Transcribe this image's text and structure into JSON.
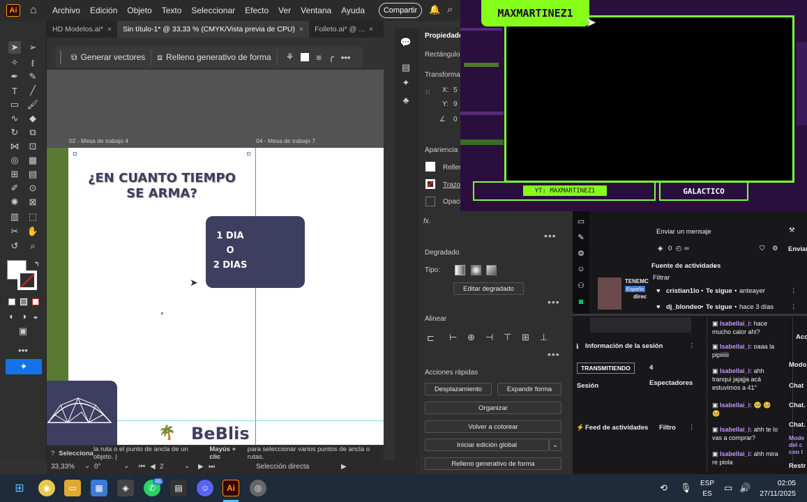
{
  "app": {
    "logo": "Ai",
    "menu": [
      "Archivo",
      "Edición",
      "Objeto",
      "Texto",
      "Seleccionar",
      "Efecto",
      "Ver",
      "Ventana",
      "Ayuda"
    ],
    "share_label": "Compartir"
  },
  "tabs": [
    {
      "label": "HD Modelos.ai*",
      "close": "×",
      "active": false
    },
    {
      "label": "Sin título-1* @ 33,33 % (CMYK/Vista previa de CPU)",
      "close": "×",
      "active": true
    },
    {
      "label": "Folleto.ai* @ ...",
      "close": "×",
      "active": false
    }
  ],
  "context_bar": {
    "generate_vectors": "Generar vectores",
    "generative_fill": "Relleno generativo de forma"
  },
  "canvas": {
    "artboard_labels": [
      "02 - Mesa de trabajo 4",
      "04 - Mesa de trabajo 7"
    ],
    "headline_line1": "¿EN CUANTO TIEMPO",
    "headline_line2": "SE ARMA?",
    "days_line1": "1 DIA",
    "days_line2": "O",
    "days_line3": "2 DIAS",
    "brand": "BeBlis"
  },
  "hint": {
    "bold1": "Selecciona",
    "text1": " la ruta o el punto de ancla de un objeto. | ",
    "bold2": "Mayús + clic",
    "text2": " para seleccionar varios puntos de ancla o rutas."
  },
  "status": {
    "zoom": "33,33%",
    "rotation": "0°",
    "artboard_num": "2",
    "tool": "Selección directa"
  },
  "properties": {
    "tab": "Propiedades",
    "object_type": "Rectángulo",
    "transform_title": "Transformar",
    "x_label": "X:",
    "x_value": "5",
    "y_label": "Y:",
    "y_value": "9",
    "angle_value": "0",
    "appearance_title": "Apariencia",
    "fill_label": "Relleno",
    "stroke_label": "Trazo",
    "opacity_label": "Opacidad",
    "fx": "fx.",
    "gradient_title": "Degradado",
    "type_label": "Tipo:",
    "edit_gradient": "Editar degradado",
    "align_title": "Alinear",
    "quick_actions_title": "Acciones rápidas",
    "btn_offset": "Desplazamiento",
    "btn_expand": "Expandir forma",
    "btn_arrange": "Organizar",
    "btn_recolor": "Volver a colorear",
    "btn_global_edit": "Iniciar edición global",
    "btn_generative": "Relleno generativo de forma"
  },
  "stream": {
    "name": "MAXMARTINEZ1",
    "yt_label": "YT: MAXMARTINEZ1",
    "galactico": "GALACTICO"
  },
  "dashboard": {
    "send_message": "Enviar un mensaje",
    "points": "0",
    "send": "Enviar",
    "activity_feed_title": "Fuente de actividades",
    "filter": "Filtrar",
    "stream_title": "TENEMC",
    "stream_lang": "Españo",
    "stream_sub": "direc",
    "follows": [
      {
        "user": "cristian1lo",
        "action": "Te sigue",
        "time": "anteayer"
      },
      {
        "user": "dj_blondeo",
        "action": "Te sigue",
        "time": "hace 3 días"
      }
    ],
    "session_info": "Información de la sesión",
    "live_badge": "TRANSMITIENDO",
    "viewers": "4",
    "viewers_label": "Espectadores",
    "session_label": "Sesión",
    "feed_title": "Feed de actividades",
    "feed_filter": "Filtro",
    "chat": [
      {
        "user": "Isabellai_i:",
        "msg": "hace mucho calor ahi?"
      },
      {
        "user": "Isabellai_i:",
        "msg": "oaaa la pipiiiiii"
      },
      {
        "user": "Isabellai_i:",
        "msg": "ahh tranqui jajajja acá estuvimos a 41°"
      },
      {
        "user": "Isabellai_i:",
        "msg": "🥺 🥺🥺"
      },
      {
        "user": "Isabellai_i:",
        "msg": "ahh te lo vas a comprar?"
      },
      {
        "user": "Isabellai_i:",
        "msg": "ahh mira re piola"
      }
    ],
    "right_cut": [
      "Acc",
      "Modo",
      "Chat",
      "Chat.",
      "Chat.",
      "Mode del c con l",
      "Restr"
    ]
  },
  "taskbar": {
    "lang_top": "ESP",
    "lang_bottom": "ES",
    "time": "02:05",
    "date": "27/11/2025",
    "whatsapp_badge": "46"
  },
  "colors": {
    "accent_blue": "#1473e6",
    "navy": "#3d3e60",
    "neon_green": "#86ff1a",
    "purple_bg": "#2a0f3d"
  }
}
